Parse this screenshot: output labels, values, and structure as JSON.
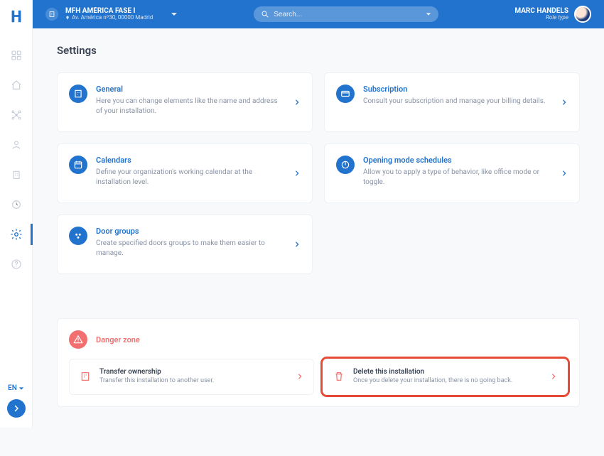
{
  "header": {
    "installation_title": "MFH AMÉRICA FASE I",
    "installation_address": "Av. América nº30, 00000 Madrid",
    "search_placeholder": "Search...",
    "user_name": "MARC HANDELS",
    "user_role": "Role type"
  },
  "sidebar": {
    "language": "EN"
  },
  "page": {
    "title": "Settings"
  },
  "cards": {
    "general": {
      "title": "General",
      "desc": "Here you can change elements like the name and address of your installation."
    },
    "subscription": {
      "title": "Subscription",
      "desc": "Consult your subscription and manage your billing details."
    },
    "calendars": {
      "title": "Calendars",
      "desc": "Define your organization's working calendar at the installation level."
    },
    "schedules": {
      "title": "Opening mode schedules",
      "desc": "Allow you to apply a type of behavior, like office mode or toggle."
    },
    "doorgroups": {
      "title": "Door groups",
      "desc": "Create specified doors groups to make them easier to manage."
    }
  },
  "danger": {
    "title": "Danger zone",
    "transfer": {
      "title": "Transfer ownership",
      "desc": "Transfer this installation to another user."
    },
    "delete": {
      "title": "Delete this installation",
      "desc": "Once you delete your installation, there is no going back."
    }
  }
}
